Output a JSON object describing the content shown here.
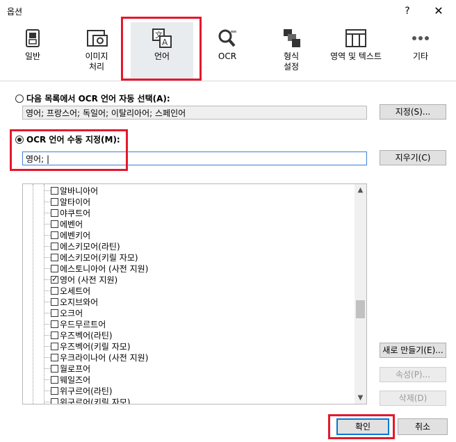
{
  "window": {
    "title": "옵션",
    "help": "?",
    "close": "✕"
  },
  "tabs": [
    {
      "label": "일반"
    },
    {
      "label": "이미지\n처리"
    },
    {
      "label": "언어"
    },
    {
      "label": "OCR"
    },
    {
      "label": "형식\n설정"
    },
    {
      "label": "영역 및 텍스트"
    },
    {
      "label": "기타"
    }
  ],
  "auto_select": {
    "label": "다음 목록에서 OCR 언어 자동 선택(A):",
    "value": "영어; 프랑스어; 독일어; 이탈리아어; 스페인어",
    "button": "지정(S)..."
  },
  "manual": {
    "label": "OCR 언어 수동 지정(M):",
    "value": "영어; |",
    "clear_button": "지우기(C)"
  },
  "languages": [
    {
      "name": "알바니아어",
      "checked": false
    },
    {
      "name": "알타이어",
      "checked": false
    },
    {
      "name": "야쿠트어",
      "checked": false
    },
    {
      "name": "에벤어",
      "checked": false
    },
    {
      "name": "에벤키어",
      "checked": false
    },
    {
      "name": "에스키모어(라틴)",
      "checked": false
    },
    {
      "name": "에스키모어(키릴 자모)",
      "checked": false
    },
    {
      "name": "에스토니아어 (사전 지원)",
      "checked": false
    },
    {
      "name": "영어 (사전 지원)",
      "checked": true
    },
    {
      "name": "오세트어",
      "checked": false
    },
    {
      "name": "오지브와어",
      "checked": false
    },
    {
      "name": "오크어",
      "checked": false
    },
    {
      "name": "우드무르트어",
      "checked": false
    },
    {
      "name": "우즈벡어(라틴)",
      "checked": false
    },
    {
      "name": "우즈벡어(키릴 자모)",
      "checked": false
    },
    {
      "name": "우크라이나어 (사전 지원)",
      "checked": false
    },
    {
      "name": "월로프어",
      "checked": false
    },
    {
      "name": "웨일즈어",
      "checked": false
    },
    {
      "name": "위구르어(라틴)",
      "checked": false
    },
    {
      "name": "위구르어(키릴 자모)",
      "checked": false
    }
  ],
  "side_buttons": {
    "new": "새로 만들기(E)...",
    "props": "속성(P)...",
    "delete": "삭제(D)"
  },
  "footer": {
    "ok": "확인",
    "cancel": "취소"
  }
}
